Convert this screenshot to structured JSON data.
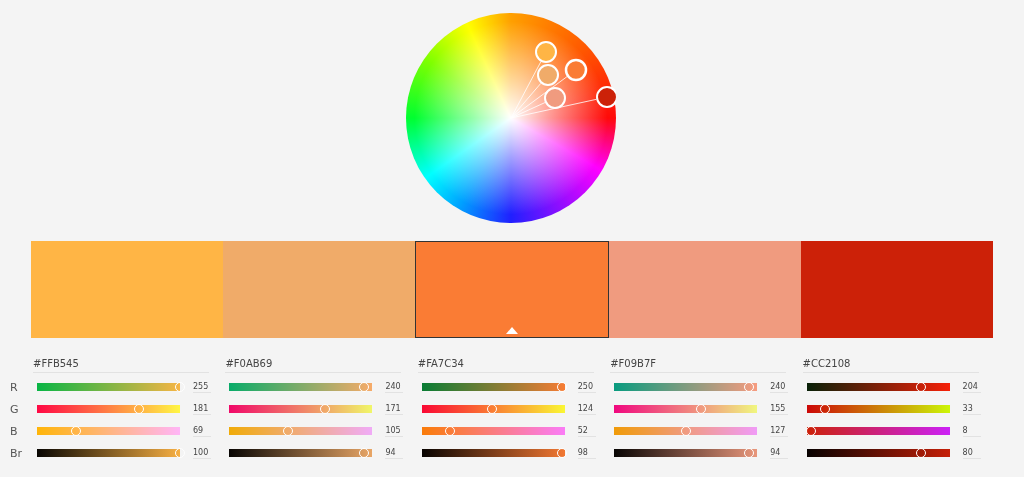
{
  "channel_labels": [
    "R",
    "G",
    "B",
    "Br"
  ],
  "swatches": [
    {
      "hex": "#FFB545",
      "color": "#ffb545",
      "selected": false,
      "channels": [
        {
          "value": "255",
          "level": 1.0
        },
        {
          "value": "181",
          "level": 0.71
        },
        {
          "value": "69",
          "level": 0.27
        },
        {
          "value": "100",
          "level": 1.0
        }
      ]
    },
    {
      "hex": "#F0AB69",
      "color": "#f0ab69",
      "selected": false,
      "channels": [
        {
          "value": "240",
          "level": 0.94
        },
        {
          "value": "171",
          "level": 0.67
        },
        {
          "value": "105",
          "level": 0.41
        },
        {
          "value": "94",
          "level": 0.94
        }
      ]
    },
    {
      "hex": "#FA7C34",
      "color": "#fa7c34",
      "selected": true,
      "channels": [
        {
          "value": "250",
          "level": 0.98
        },
        {
          "value": "124",
          "level": 0.49
        },
        {
          "value": "52",
          "level": 0.2
        },
        {
          "value": "98",
          "level": 0.98
        }
      ]
    },
    {
      "hex": "#F09B7F",
      "color": "#f09b7f",
      "selected": false,
      "channels": [
        {
          "value": "240",
          "level": 0.94
        },
        {
          "value": "155",
          "level": 0.61
        },
        {
          "value": "127",
          "level": 0.5
        },
        {
          "value": "94",
          "level": 0.94
        }
      ]
    },
    {
      "hex": "#CC2108",
      "color": "#cc2108",
      "selected": false,
      "channels": [
        {
          "value": "204",
          "level": 0.8
        },
        {
          "value": "33",
          "level": 0.13
        },
        {
          "value": "8",
          "level": 0.03
        },
        {
          "value": "80",
          "level": 0.8
        }
      ]
    }
  ]
}
